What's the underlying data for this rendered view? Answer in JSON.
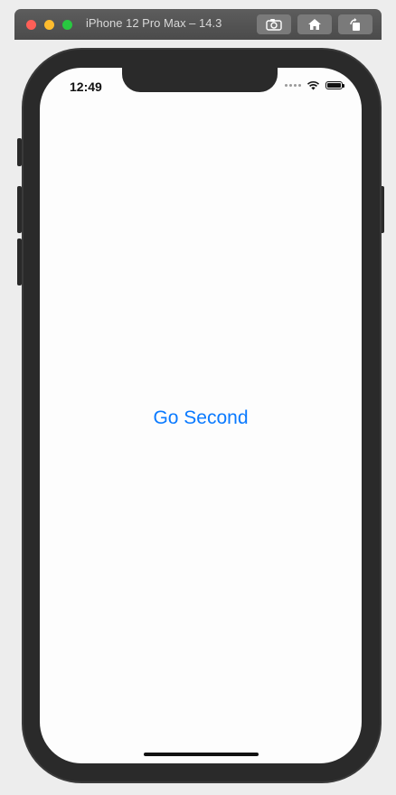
{
  "window": {
    "title": "iPhone 12 Pro Max – 14.3",
    "toolbar": {
      "screenshot_icon": "camera-icon",
      "home_icon": "home-icon",
      "rotate_icon": "rotate-icon"
    }
  },
  "status_bar": {
    "time": "12:49",
    "wifi_icon": "wifi-icon",
    "battery_icon": "battery-icon"
  },
  "main": {
    "button_label": "Go Second"
  },
  "colors": {
    "accent": "#0a7aff",
    "close": "#ff5f57",
    "minimize": "#febc2e",
    "maximize": "#28c840"
  }
}
